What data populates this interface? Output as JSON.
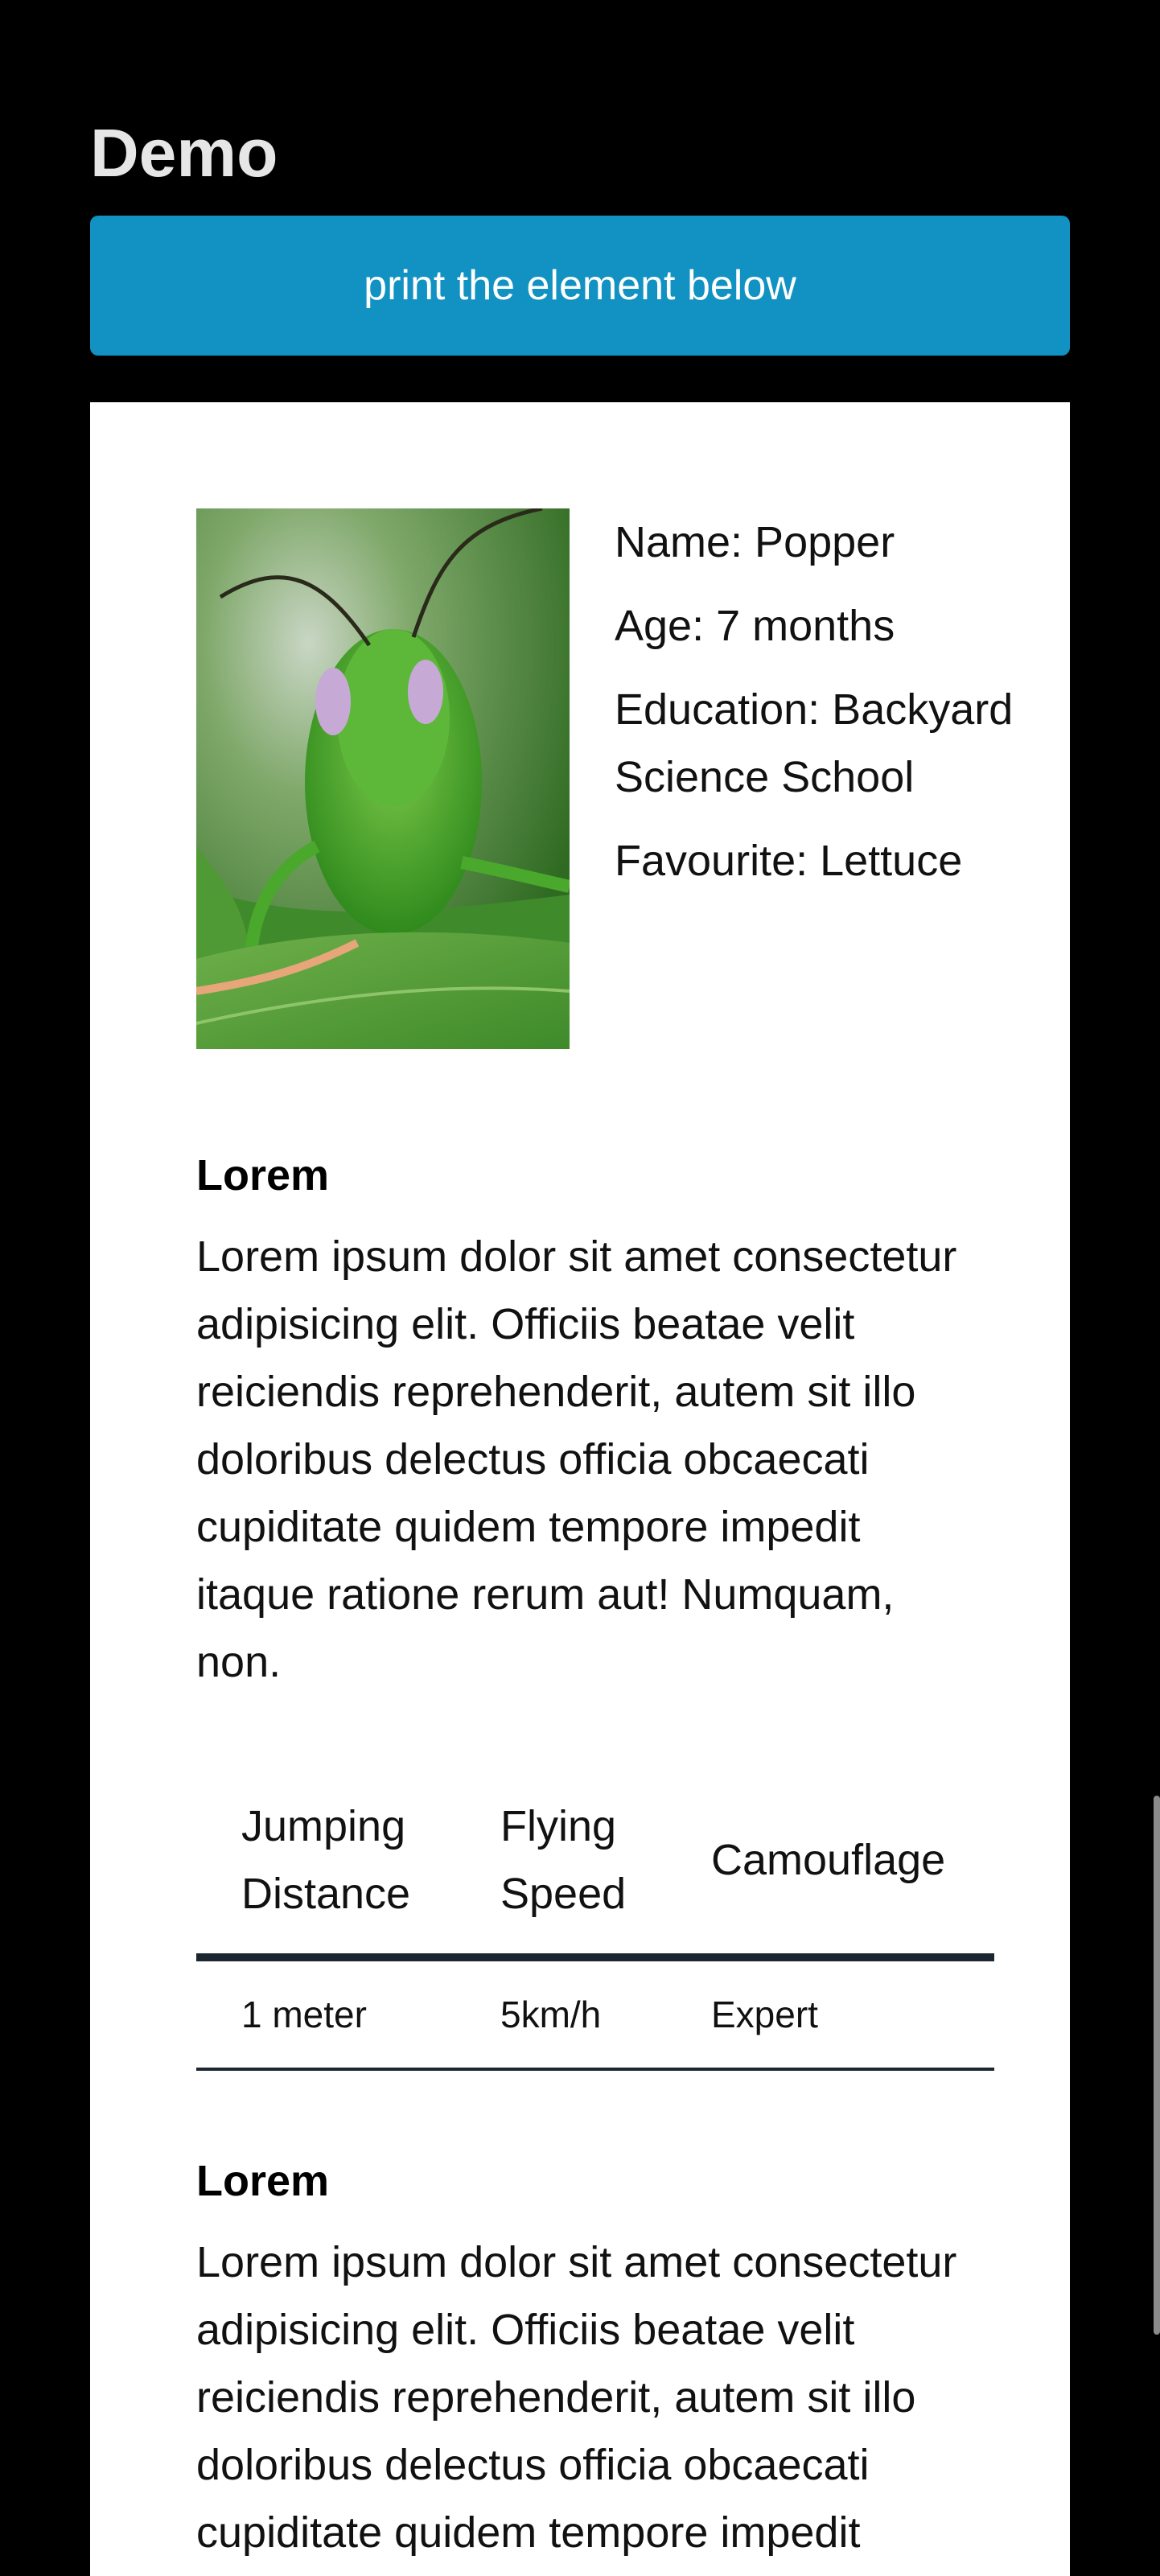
{
  "header": {
    "title": "Demo",
    "print_button_label": "print the element below"
  },
  "profile": {
    "photo_icon": "grasshopper-photo",
    "name_line": "Name: Popper",
    "age_line": "Age: 7 months",
    "education_line": "Education: Backyard Science School",
    "favourite_line": "Favourite: Lettuce"
  },
  "sections": [
    {
      "heading": "Lorem",
      "text": "Lorem ipsum dolor sit amet consectetur adipisicing elit. Officiis beatae velit reiciendis reprehenderit, autem sit illo doloribus delectus officia obcaecati cupiditate quidem tempore impedit itaque ratione rerum aut! Numquam, non."
    },
    {
      "heading": "Lorem",
      "text": "Lorem ipsum dolor sit amet consectetur adipisicing elit. Officiis beatae velit reiciendis reprehenderit, autem sit illo doloribus delectus officia obcaecati cupiditate quidem tempore impedit itaque ratione rerum aut!"
    }
  ],
  "table": {
    "headers": [
      "Jumping Distance",
      "Flying Speed",
      "Camouflage"
    ],
    "rows": [
      [
        "1 meter",
        "5km/h",
        "Expert"
      ]
    ]
  },
  "colors": {
    "background": "#000000",
    "accent": "#1192c2",
    "card": "#ffffff",
    "table_rule": "#1b2631"
  }
}
